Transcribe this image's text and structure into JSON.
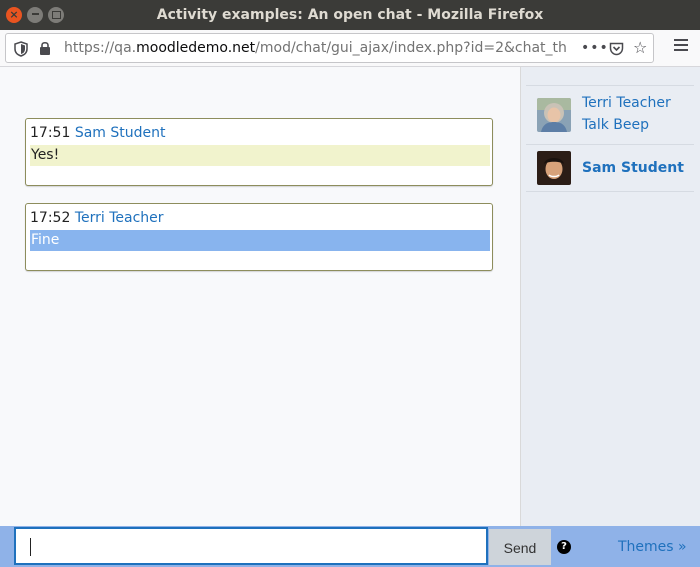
{
  "window": {
    "title": "Activity examples: An open chat - Mozilla Firefox"
  },
  "navbar": {
    "url_prefix": "https://qa.",
    "url_host": "moodledemo.net",
    "url_path": "/mod/chat/gui_ajax/index.php?id=2&chat_th",
    "overflow": "•••"
  },
  "messages": [
    {
      "time": "17:51",
      "author": "Sam Student",
      "text": "Yes!",
      "highlight_color": "#f1f3cd"
    },
    {
      "time": "17:52",
      "author": "Terri Teacher",
      "text": "Fine",
      "highlight_color": "#88b4ee"
    }
  ],
  "users": [
    {
      "name": "Terri Teacher",
      "action": "Talk Beep"
    },
    {
      "name": "Sam Student"
    }
  ],
  "input": {
    "value": "",
    "send_label": "Send",
    "help_glyph": "?",
    "themes_link": "Themes »"
  },
  "colors": {
    "accent": "#1f71bd",
    "input_bar": "#8fb2e8"
  }
}
